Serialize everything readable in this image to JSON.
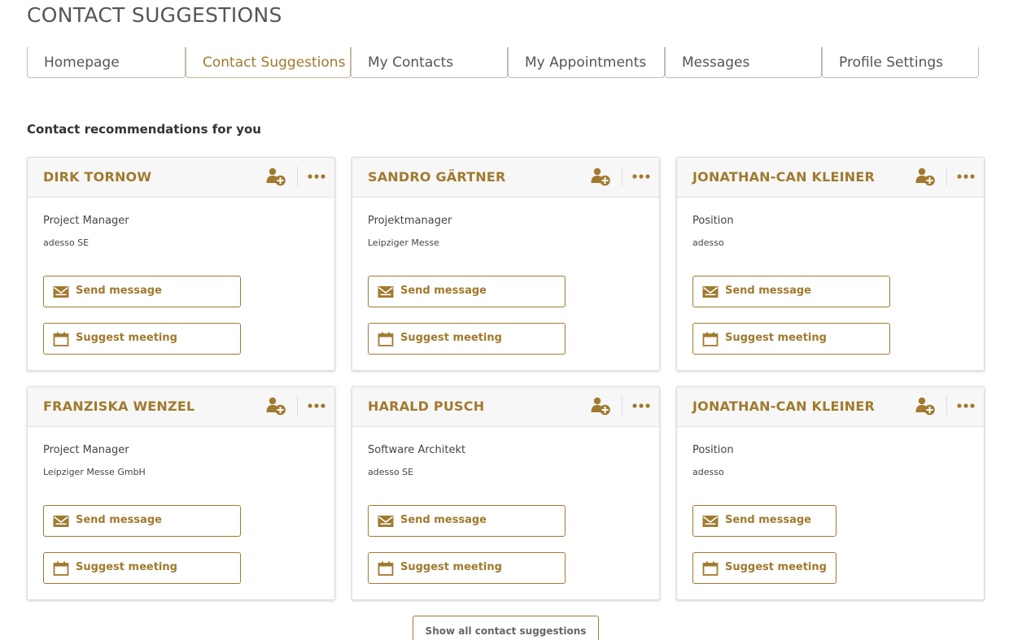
{
  "page": {
    "title": "CONTACT SUGGESTIONS"
  },
  "tabs": [
    {
      "label": "Homepage"
    },
    {
      "label": "Contact Suggestions"
    },
    {
      "label": "My Contacts"
    },
    {
      "label": "My Appointments"
    },
    {
      "label": "Messages"
    },
    {
      "label": "Profile Settings"
    }
  ],
  "active_tab": "Contact Suggestions",
  "section": {
    "title": "Contact recommendations for you"
  },
  "cards": [
    {
      "name": "DIRK TORNOW",
      "position": "Project Manager",
      "company": "adesso SE",
      "send_label": "Send message",
      "meet_label": "Suggest meeting"
    },
    {
      "name": "SANDRO GÄRTNER",
      "position": "Projektmanager",
      "company": "Leipziger Messe",
      "send_label": "Send message",
      "meet_label": "Suggest meeting"
    },
    {
      "name": "JONATHAN-CAN KLEINER",
      "position": "Position",
      "company": "adesso",
      "send_label": "Send message",
      "meet_label": "Suggest meeting"
    },
    {
      "name": "FRANZISKA WENZEL",
      "position": "Project Manager",
      "company": "Leipziger Messe GmbH",
      "send_label": "Send message",
      "meet_label": "Suggest meeting"
    },
    {
      "name": "HARALD PUSCH",
      "position": "Software Architekt",
      "company": "adesso SE",
      "send_label": "Send message",
      "meet_label": "Suggest meeting"
    },
    {
      "name": "JONATHAN-CAN KLEINER",
      "position": "Position",
      "company": "adesso",
      "send_label": "Send message",
      "meet_label": "Suggest meeting"
    }
  ],
  "footer": {
    "show_all_label": "Show all contact suggestions"
  },
  "icons": {
    "add_contact": "add-contact-icon",
    "more": "more-options-icon",
    "message": "envelope-icon",
    "meeting": "calendar-icon"
  },
  "colors": {
    "accent": "#a07a2e",
    "card_header_bg": "#f7f7f7",
    "text": "#333333"
  }
}
